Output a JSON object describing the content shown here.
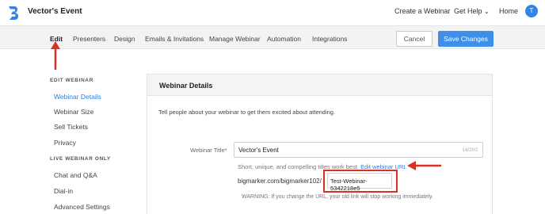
{
  "header": {
    "event_name": "Vector's Event",
    "links": {
      "create": "Create a Webinar",
      "help": "Get Help",
      "help_chevron": "⌄",
      "home": "Home"
    },
    "avatar_initial": "T"
  },
  "tabs": [
    {
      "label": "Edit",
      "active": true
    },
    {
      "label": "Presenters"
    },
    {
      "label": "Design"
    },
    {
      "label": "Emails & Invitations"
    },
    {
      "label": "Manage Webinar"
    },
    {
      "label": "Automation"
    },
    {
      "label": "Integrations"
    }
  ],
  "actions": {
    "cancel": "Cancel",
    "save": "Save Changes"
  },
  "sidebar": {
    "section1_heading": "EDIT WEBINAR",
    "section1_items": [
      {
        "label": "Webinar Details",
        "active": true
      },
      {
        "label": "Webinar Size"
      },
      {
        "label": "Sell Tickets"
      },
      {
        "label": "Privacy"
      }
    ],
    "section2_heading": "LIVE WEBINAR ONLY",
    "section2_items": [
      {
        "label": "Chat and Q&A"
      },
      {
        "label": "Dial-in"
      },
      {
        "label": "Advanced Settings"
      }
    ]
  },
  "details": {
    "title": "Webinar Details",
    "description": "Tell people about your webinar to get them excited about attending.",
    "title_field": {
      "label": "Webinar Title",
      "required_mark": "*",
      "value": "Vector's Event",
      "counter": "14/200"
    },
    "hint": "Short, unique, and compelling titles work best.",
    "hint_link": "Edit webinar URL",
    "url_prefix": "bigmarker.com/bigmarker102/",
    "url_slug": "Test-Webinar-5342218e5",
    "warning": "WARNING: If you change the URL, your old link will stop working immediately."
  },
  "colors": {
    "accent": "#2f7fd8",
    "primary_button": "#3d8fe8",
    "annotation": "#d93025",
    "tab_bar": "#f2f3f5"
  },
  "icons": {
    "logo": "bigmarker-logo-icon"
  }
}
